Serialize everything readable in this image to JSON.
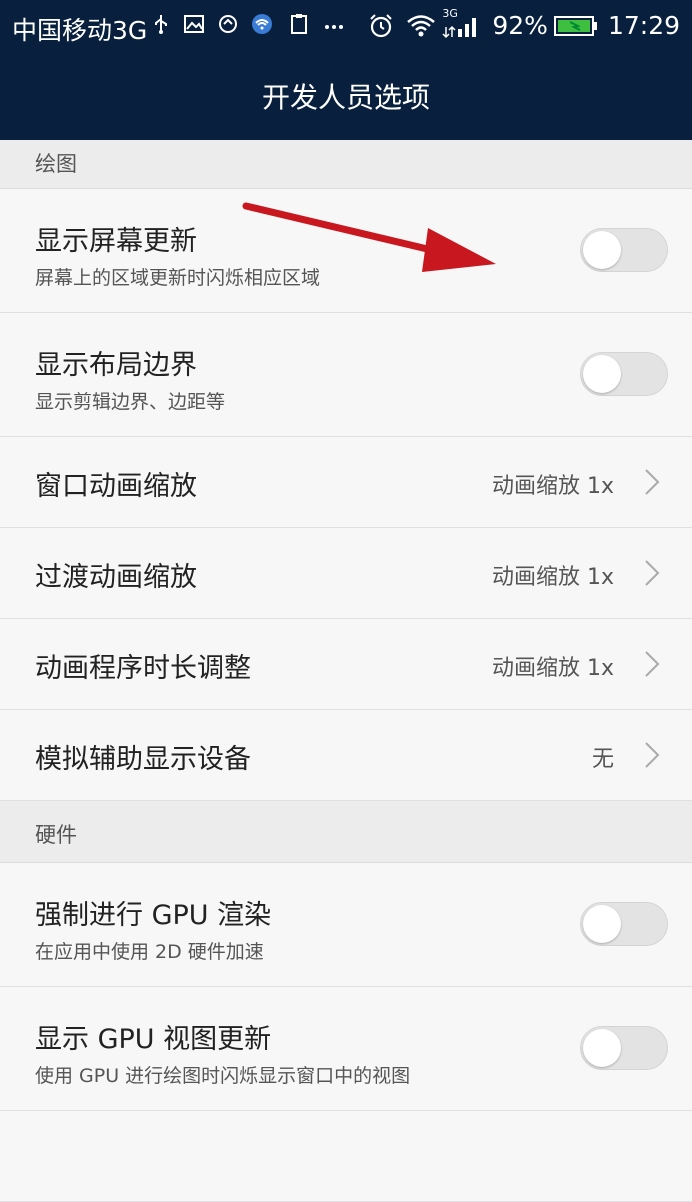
{
  "status_bar": {
    "carrier": "中国移动3G",
    "network_badge": "3G",
    "battery": "92%",
    "time": "17:29",
    "icons": [
      "usb-icon",
      "image-icon",
      "sync-icon",
      "wifi-app-icon",
      "clipboard-icon",
      "more-dots-icon",
      "alarm-icon",
      "wifi-icon",
      "signal-icon",
      "battery-charging-icon"
    ]
  },
  "header": {
    "title": "开发人员选项"
  },
  "sections": {
    "drawing": {
      "label": "绘图",
      "items": [
        {
          "title": "显示屏幕更新",
          "subtitle": "屏幕上的区域更新时闪烁相应区域",
          "toggle": "off"
        },
        {
          "title": "显示布局边界",
          "subtitle": "显示剪辑边界、边距等",
          "toggle": "off"
        },
        {
          "title": "窗口动画缩放",
          "value": "动画缩放 1x"
        },
        {
          "title": "过渡动画缩放",
          "value": "动画缩放 1x"
        },
        {
          "title": "动画程序时长调整",
          "value": "动画缩放 1x"
        },
        {
          "title": "模拟辅助显示设备",
          "value": "无"
        }
      ]
    },
    "hardware": {
      "label": "硬件",
      "items": [
        {
          "title": "强制进行 GPU 渲染",
          "subtitle": "在应用中使用 2D 硬件加速",
          "toggle": "off"
        },
        {
          "title": "显示 GPU 视图更新",
          "subtitle": "使用 GPU 进行绘图时闪烁显示窗口中的视图",
          "toggle": "off"
        }
      ]
    }
  },
  "annotation": {
    "arrow_color": "#c8171e"
  },
  "colors": {
    "header_bg": "#08203d",
    "list_bg": "#f7f7f7",
    "section_bg": "#ececec"
  }
}
